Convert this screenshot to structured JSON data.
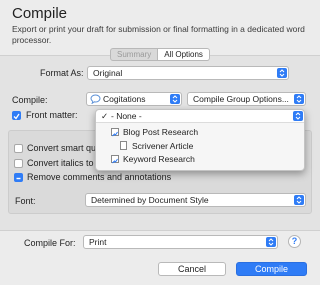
{
  "dialog": {
    "title": "Compile",
    "subtitle": "Export or print your draft for submission or final formatting in a dedicated word processor."
  },
  "tabs": [
    {
      "label": "Summary",
      "selected": true
    },
    {
      "label": "All Options",
      "selected": false
    }
  ],
  "format_as": {
    "label": "Format As:",
    "value": "Original"
  },
  "compile": {
    "label": "Compile:",
    "value": "Cogitations",
    "icon": "speech-bubble-icon",
    "group_options_label": "Compile Group Options..."
  },
  "front_matter": {
    "label": "Front matter:",
    "checked": true
  },
  "front_matter_menu": {
    "selected": "- None -",
    "items": [
      {
        "label": "Blog Post Research",
        "icon": "collection-icon"
      },
      {
        "label": "Scrivener Article",
        "icon": "document-icon"
      },
      {
        "label": "Keyword Research",
        "icon": "collection-icon"
      }
    ]
  },
  "options": [
    {
      "label": "Convert smart quotes to straight quotes",
      "state": "unchecked"
    },
    {
      "label": "Convert italics to underlines",
      "state": "unchecked"
    },
    {
      "label": "Remove comments and annotations",
      "state": "mixed"
    }
  ],
  "font": {
    "label": "Font:",
    "value": "Determined by Document Style"
  },
  "compile_for": {
    "label": "Compile For:",
    "value": "Print"
  },
  "buttons": {
    "cancel": "Cancel",
    "compile": "Compile",
    "help": "?"
  },
  "colors": {
    "accent": "#2f7cf6",
    "background": "#ececec"
  }
}
